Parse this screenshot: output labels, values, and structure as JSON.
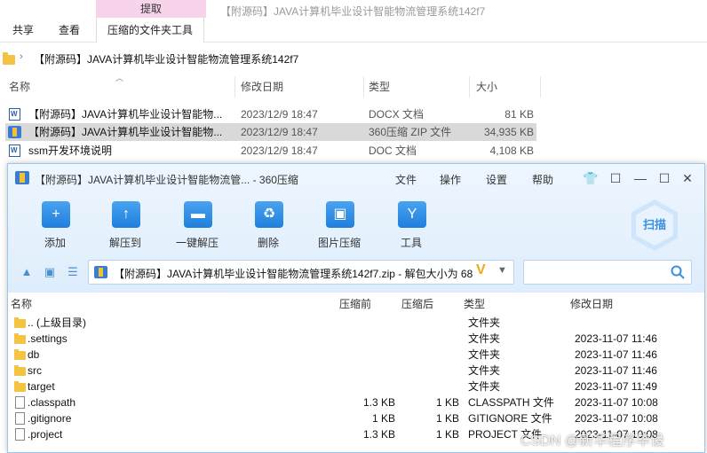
{
  "explorer": {
    "contextual_tab": "提取",
    "window_title": "【附源码】JAVA计算机毕业设计智能物流管理系统142f7",
    "ribbon_tabs": [
      "共享",
      "查看",
      "压缩的文件夹工具"
    ],
    "address_path": "【附源码】JAVA计算机毕业设计智能物流管理系统142f7",
    "columns": {
      "name": "名称",
      "date": "修改日期",
      "type": "类型",
      "size": "大小"
    },
    "files": [
      {
        "name": "【附源码】JAVA计算机毕业设计智能物...",
        "date": "2023/12/9 18:47",
        "type": "DOCX 文档",
        "size": "81 KB",
        "icon": "word-doc-icon"
      },
      {
        "name": "【附源码】JAVA计算机毕业设计智能物...",
        "date": "2023/12/9 18:47",
        "type": "360压缩 ZIP 文件",
        "size": "34,935 KB",
        "icon": "zip-archive-icon"
      },
      {
        "name": "ssm开发环境说明",
        "date": "2023/12/9 18:47",
        "type": "DOC 文档",
        "size": "4,108 KB",
        "icon": "word-doc-icon"
      }
    ]
  },
  "zip_window": {
    "title": "【附源码】JAVA计算机毕业设计智能物流管... - 360压缩",
    "menus": [
      "文件",
      "操作",
      "设置",
      "帮助"
    ],
    "toolbar": [
      {
        "label": "添加",
        "icon": "add-icon",
        "glyph": "+"
      },
      {
        "label": "解压到",
        "icon": "extract-to-icon",
        "glyph": "↑"
      },
      {
        "label": "一键解压",
        "icon": "one-click-extract-icon",
        "glyph": "▬"
      },
      {
        "label": "删除",
        "icon": "recycle-icon",
        "glyph": "♻"
      },
      {
        "label": "图片压缩",
        "icon": "image-compress-icon",
        "glyph": "▣"
      },
      {
        "label": "工具",
        "icon": "tools-icon",
        "glyph": "Y"
      }
    ],
    "scan_label": "扫描",
    "path_text": "【附源码】JAVA计算机毕业设计智能物流管理系统142f7.zip - 解包大小为 68",
    "columns": {
      "name": "名称",
      "before": "压缩前",
      "after": "压缩后",
      "type": "类型",
      "date": "修改日期"
    },
    "rows": [
      {
        "name": ".. (上级目录)",
        "before": "",
        "after": "",
        "type": "文件夹",
        "date": "",
        "kind": "folder"
      },
      {
        "name": ".settings",
        "before": "",
        "after": "",
        "type": "文件夹",
        "date": "2023-11-07 11:46",
        "kind": "folder"
      },
      {
        "name": "db",
        "before": "",
        "after": "",
        "type": "文件夹",
        "date": "2023-11-07 11:46",
        "kind": "folder"
      },
      {
        "name": "src",
        "before": "",
        "after": "",
        "type": "文件夹",
        "date": "2023-11-07 11:46",
        "kind": "folder"
      },
      {
        "name": "target",
        "before": "",
        "after": "",
        "type": "文件夹",
        "date": "2023-11-07 11:49",
        "kind": "folder"
      },
      {
        "name": ".classpath",
        "before": "1.3 KB",
        "after": "1 KB",
        "type": "CLASSPATH 文件",
        "date": "2023-11-07 10:08",
        "kind": "file"
      },
      {
        "name": ".gitignore",
        "before": "1 KB",
        "after": "1 KB",
        "type": "GITIGNORE 文件",
        "date": "2023-11-07 10:08",
        "kind": "file"
      },
      {
        "name": ".project",
        "before": "1.3 KB",
        "after": "1 KB",
        "type": "PROJECT 文件",
        "date": "2023-11-07 10:08",
        "kind": "file"
      }
    ]
  },
  "watermark": "CSDN @新华程序毕设"
}
